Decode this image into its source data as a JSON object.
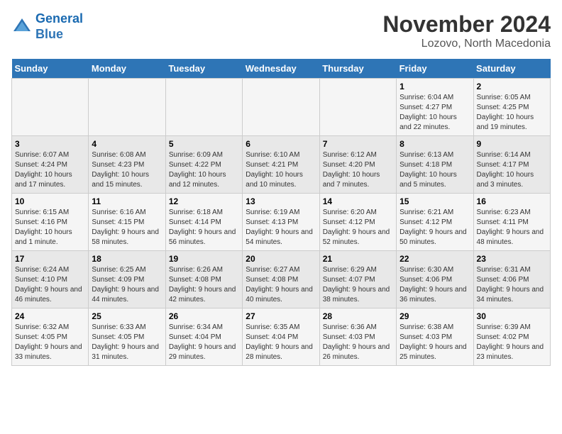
{
  "header": {
    "logo_line1": "General",
    "logo_line2": "Blue",
    "title": "November 2024",
    "subtitle": "Lozovo, North Macedonia"
  },
  "days_of_week": [
    "Sunday",
    "Monday",
    "Tuesday",
    "Wednesday",
    "Thursday",
    "Friday",
    "Saturday"
  ],
  "weeks": [
    [
      {
        "num": "",
        "info": ""
      },
      {
        "num": "",
        "info": ""
      },
      {
        "num": "",
        "info": ""
      },
      {
        "num": "",
        "info": ""
      },
      {
        "num": "",
        "info": ""
      },
      {
        "num": "1",
        "info": "Sunrise: 6:04 AM\nSunset: 4:27 PM\nDaylight: 10 hours and 22 minutes."
      },
      {
        "num": "2",
        "info": "Sunrise: 6:05 AM\nSunset: 4:25 PM\nDaylight: 10 hours and 19 minutes."
      }
    ],
    [
      {
        "num": "3",
        "info": "Sunrise: 6:07 AM\nSunset: 4:24 PM\nDaylight: 10 hours and 17 minutes."
      },
      {
        "num": "4",
        "info": "Sunrise: 6:08 AM\nSunset: 4:23 PM\nDaylight: 10 hours and 15 minutes."
      },
      {
        "num": "5",
        "info": "Sunrise: 6:09 AM\nSunset: 4:22 PM\nDaylight: 10 hours and 12 minutes."
      },
      {
        "num": "6",
        "info": "Sunrise: 6:10 AM\nSunset: 4:21 PM\nDaylight: 10 hours and 10 minutes."
      },
      {
        "num": "7",
        "info": "Sunrise: 6:12 AM\nSunset: 4:20 PM\nDaylight: 10 hours and 7 minutes."
      },
      {
        "num": "8",
        "info": "Sunrise: 6:13 AM\nSunset: 4:18 PM\nDaylight: 10 hours and 5 minutes."
      },
      {
        "num": "9",
        "info": "Sunrise: 6:14 AM\nSunset: 4:17 PM\nDaylight: 10 hours and 3 minutes."
      }
    ],
    [
      {
        "num": "10",
        "info": "Sunrise: 6:15 AM\nSunset: 4:16 PM\nDaylight: 10 hours and 1 minute."
      },
      {
        "num": "11",
        "info": "Sunrise: 6:16 AM\nSunset: 4:15 PM\nDaylight: 9 hours and 58 minutes."
      },
      {
        "num": "12",
        "info": "Sunrise: 6:18 AM\nSunset: 4:14 PM\nDaylight: 9 hours and 56 minutes."
      },
      {
        "num": "13",
        "info": "Sunrise: 6:19 AM\nSunset: 4:13 PM\nDaylight: 9 hours and 54 minutes."
      },
      {
        "num": "14",
        "info": "Sunrise: 6:20 AM\nSunset: 4:12 PM\nDaylight: 9 hours and 52 minutes."
      },
      {
        "num": "15",
        "info": "Sunrise: 6:21 AM\nSunset: 4:12 PM\nDaylight: 9 hours and 50 minutes."
      },
      {
        "num": "16",
        "info": "Sunrise: 6:23 AM\nSunset: 4:11 PM\nDaylight: 9 hours and 48 minutes."
      }
    ],
    [
      {
        "num": "17",
        "info": "Sunrise: 6:24 AM\nSunset: 4:10 PM\nDaylight: 9 hours and 46 minutes."
      },
      {
        "num": "18",
        "info": "Sunrise: 6:25 AM\nSunset: 4:09 PM\nDaylight: 9 hours and 44 minutes."
      },
      {
        "num": "19",
        "info": "Sunrise: 6:26 AM\nSunset: 4:08 PM\nDaylight: 9 hours and 42 minutes."
      },
      {
        "num": "20",
        "info": "Sunrise: 6:27 AM\nSunset: 4:08 PM\nDaylight: 9 hours and 40 minutes."
      },
      {
        "num": "21",
        "info": "Sunrise: 6:29 AM\nSunset: 4:07 PM\nDaylight: 9 hours and 38 minutes."
      },
      {
        "num": "22",
        "info": "Sunrise: 6:30 AM\nSunset: 4:06 PM\nDaylight: 9 hours and 36 minutes."
      },
      {
        "num": "23",
        "info": "Sunrise: 6:31 AM\nSunset: 4:06 PM\nDaylight: 9 hours and 34 minutes."
      }
    ],
    [
      {
        "num": "24",
        "info": "Sunrise: 6:32 AM\nSunset: 4:05 PM\nDaylight: 9 hours and 33 minutes."
      },
      {
        "num": "25",
        "info": "Sunrise: 6:33 AM\nSunset: 4:05 PM\nDaylight: 9 hours and 31 minutes."
      },
      {
        "num": "26",
        "info": "Sunrise: 6:34 AM\nSunset: 4:04 PM\nDaylight: 9 hours and 29 minutes."
      },
      {
        "num": "27",
        "info": "Sunrise: 6:35 AM\nSunset: 4:04 PM\nDaylight: 9 hours and 28 minutes."
      },
      {
        "num": "28",
        "info": "Sunrise: 6:36 AM\nSunset: 4:03 PM\nDaylight: 9 hours and 26 minutes."
      },
      {
        "num": "29",
        "info": "Sunrise: 6:38 AM\nSunset: 4:03 PM\nDaylight: 9 hours and 25 minutes."
      },
      {
        "num": "30",
        "info": "Sunrise: 6:39 AM\nSunset: 4:02 PM\nDaylight: 9 hours and 23 minutes."
      }
    ]
  ]
}
